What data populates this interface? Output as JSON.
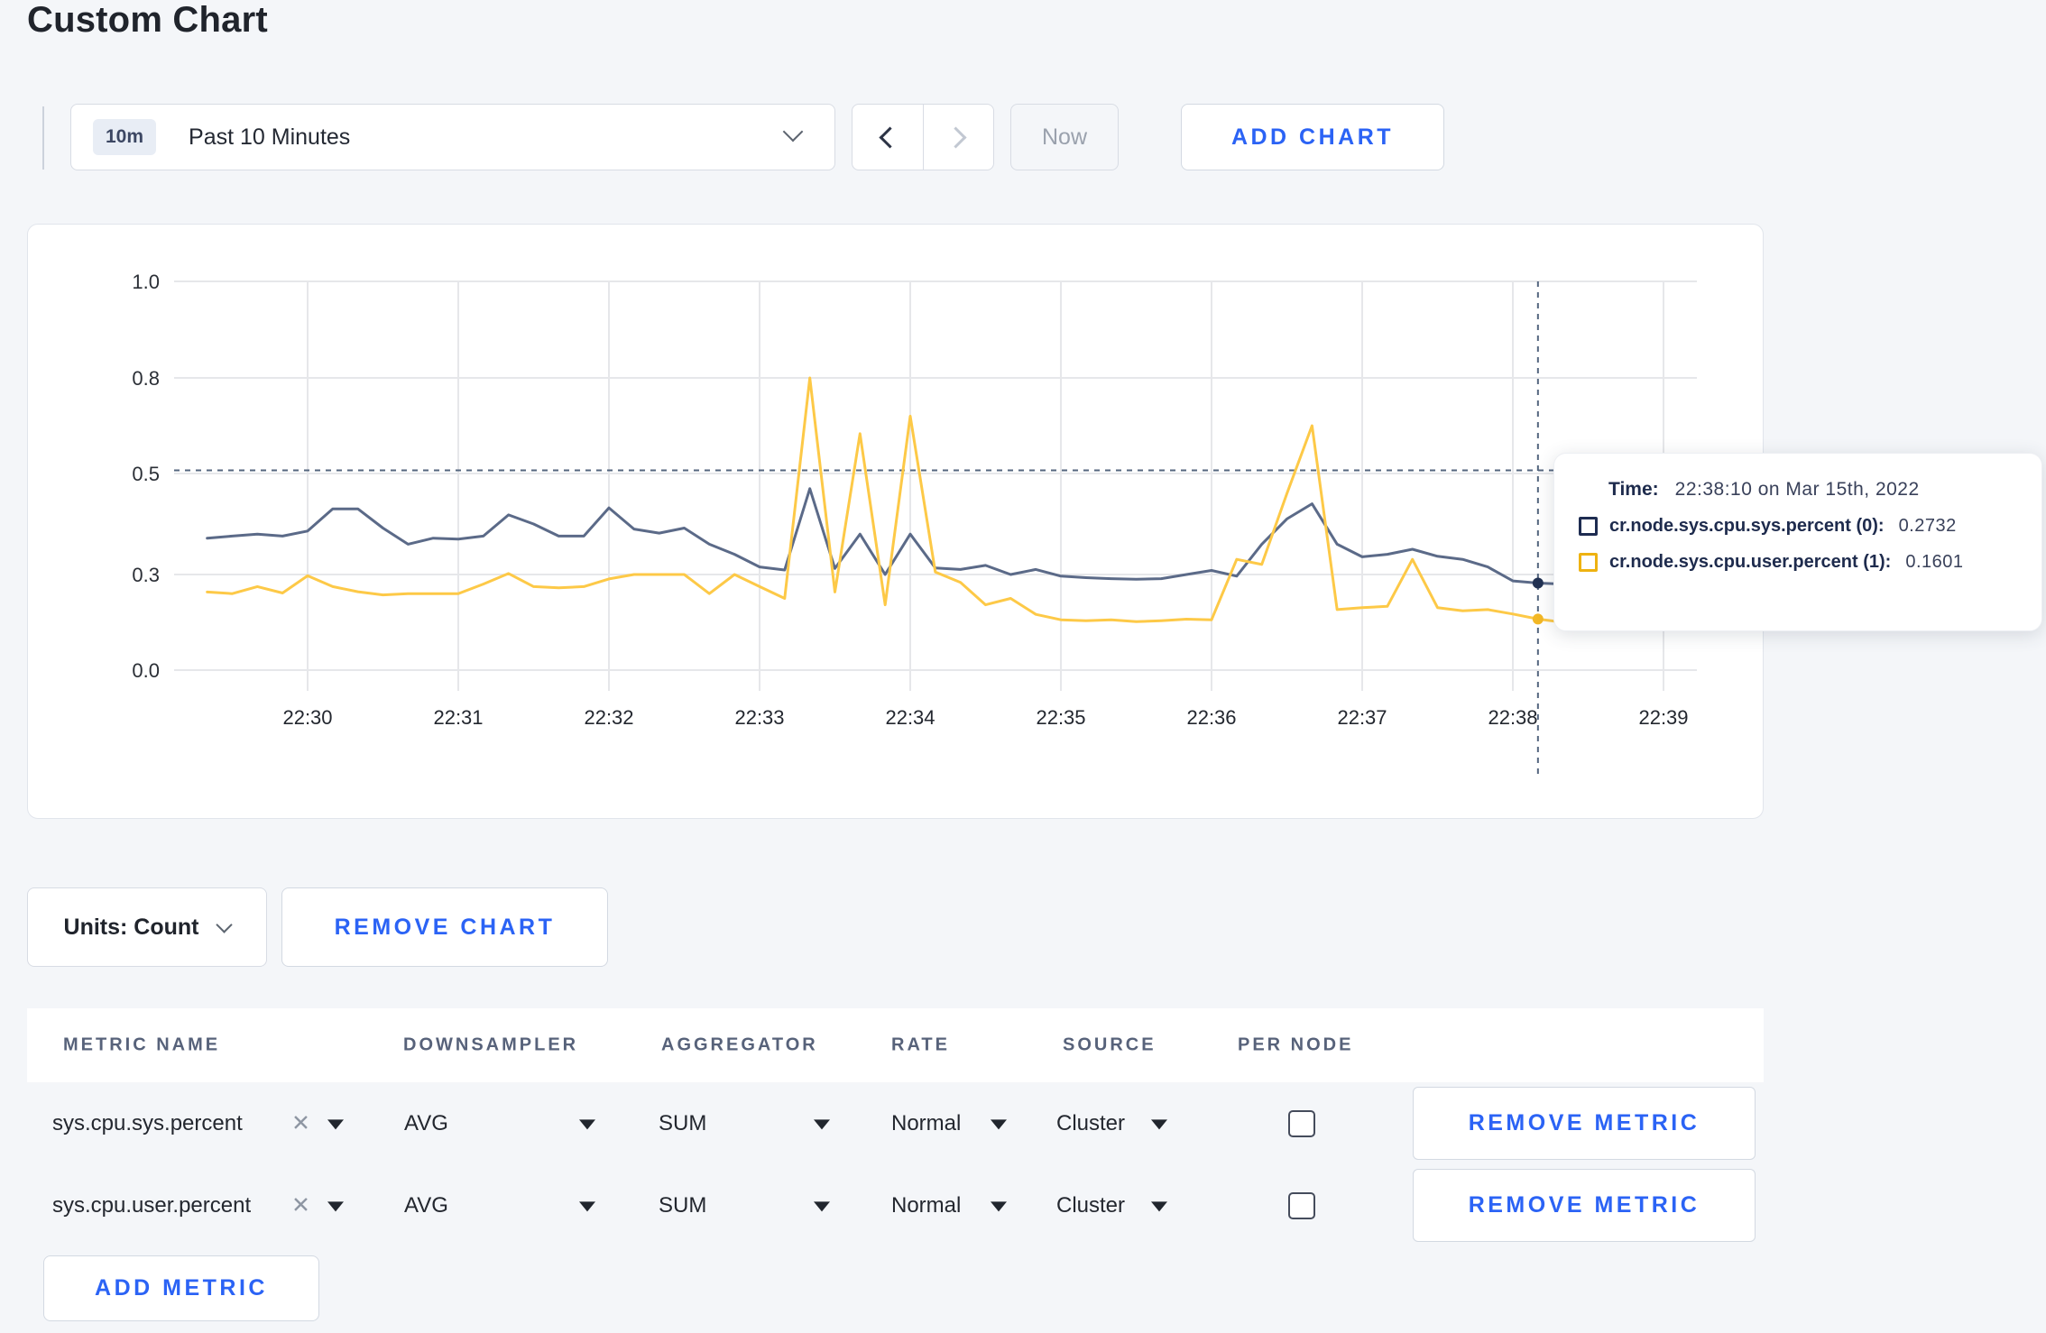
{
  "page": {
    "title": "Custom Chart"
  },
  "toolbar": {
    "time_range": {
      "badge": "10m",
      "label": "Past 10 Minutes"
    },
    "now_label": "Now",
    "add_chart_label": "ADD CHART"
  },
  "chart": {
    "tooltip": {
      "time_label": "Time:",
      "time_value": "22:38:10 on Mar 15th, 2022",
      "series": [
        {
          "name": "cr.node.sys.cpu.sys.percent (0):",
          "value": "0.2732",
          "swatch": "#1e2c51"
        },
        {
          "name": "cr.node.sys.cpu.user.percent (1):",
          "value": "0.1601",
          "swatch": "#eeb211"
        }
      ]
    }
  },
  "chart_data": {
    "type": "line",
    "title": "",
    "xlabel": "",
    "ylabel": "",
    "ylim": [
      0.0,
      1.0
    ],
    "grid": true,
    "legend_position": "tooltip-only",
    "y_tick_values": [
      0.0,
      0.3,
      0.5,
      0.8,
      1.0
    ],
    "y_tick_labels": [
      "0.0",
      "0.3",
      "0.5",
      "0.8",
      "1.0"
    ],
    "y_ticks_note": "gridlines are equally spaced in pixels despite non-uniform value steps",
    "x_axis_labels": [
      "22:30",
      "22:31",
      "22:32",
      "22:33",
      "22:34",
      "22:35",
      "22:36",
      "22:37",
      "22:38",
      "22:39"
    ],
    "x_start_time": "22:29:20",
    "x_interval_seconds": 10,
    "x_start_offset_minutes": -0.6667,
    "x_step_minutes": 0.16667,
    "series": [
      {
        "name": "cr.node.sys.cpu.sys.percent (0)",
        "color": "#5b6a88",
        "values": [
          0.372,
          0.376,
          0.38,
          0.376,
          0.386,
          0.43,
          0.43,
          0.392,
          0.36,
          0.372,
          0.37,
          0.376,
          0.418,
          0.4,
          0.376,
          0.376,
          0.432,
          0.39,
          0.382,
          0.392,
          0.36,
          0.34,
          0.315,
          0.309,
          0.47,
          0.312,
          0.38,
          0.3,
          0.38,
          0.313,
          0.31,
          0.318,
          0.3,
          0.31,
          0.295,
          0.29,
          0.287,
          0.285,
          0.287,
          0.3,
          0.308,
          0.295,
          0.36,
          0.41,
          0.44,
          0.36,
          0.335,
          0.34,
          0.35,
          0.336,
          0.33,
          0.315,
          0.28,
          0.2732,
          0.27,
          0.285,
          0.3,
          0.325,
          0.305,
          0.31
        ]
      },
      {
        "name": "cr.node.sys.cpu.user.percent (1)",
        "color": "#fdc947",
        "values": [
          0.245,
          0.24,
          0.262,
          0.242,
          0.296,
          0.262,
          0.246,
          0.236,
          0.24,
          0.24,
          0.24,
          0.27,
          0.302,
          0.262,
          0.258,
          0.262,
          0.286,
          0.3,
          0.3,
          0.3,
          0.24,
          0.3,
          0.262,
          0.225,
          0.8,
          0.245,
          0.625,
          0.205,
          0.68,
          0.305,
          0.275,
          0.205,
          0.225,
          0.175,
          0.158,
          0.155,
          0.158,
          0.152,
          0.155,
          0.16,
          0.158,
          0.33,
          0.32,
          0.46,
          0.65,
          0.19,
          0.196,
          0.2,
          0.33,
          0.196,
          0.186,
          0.19,
          0.176,
          0.1601,
          0.15,
          0.156,
          0.24,
          0.3,
          0.152,
          0.27
        ]
      }
    ],
    "crosshair": {
      "time": "22:38:10",
      "x_offset_minutes": 8.1667,
      "hline_value": 0.51,
      "points": [
        {
          "series_index": 0,
          "value": 0.2732
        },
        {
          "series_index": 1,
          "value": 0.1601
        }
      ]
    }
  },
  "chart_footer": {
    "units_label": "Units: Count",
    "remove_chart_label": "REMOVE CHART"
  },
  "metrics_table": {
    "headers": [
      "METRIC NAME",
      "DOWNSAMPLER",
      "AGGREGATOR",
      "RATE",
      "SOURCE",
      "PER NODE"
    ],
    "rows": [
      {
        "metric": "sys.cpu.sys.percent",
        "downsampler": "AVG",
        "aggregator": "SUM",
        "rate": "Normal",
        "source": "Cluster",
        "per_node_checked": false,
        "remove_label": "REMOVE METRIC"
      },
      {
        "metric": "sys.cpu.user.percent",
        "downsampler": "AVG",
        "aggregator": "SUM",
        "rate": "Normal",
        "source": "Cluster",
        "per_node_checked": false,
        "remove_label": "REMOVE METRIC"
      }
    ],
    "add_metric_label": "ADD METRIC",
    "clear_icon": "✕"
  },
  "colors": {
    "accent_blue": "#2b63f5",
    "page_bg": "#f4f6f9",
    "grid_line": "#e6e7ea",
    "crosshair": "#54667f",
    "series_sys": "#5b6a88",
    "series_user": "#fdc947"
  }
}
